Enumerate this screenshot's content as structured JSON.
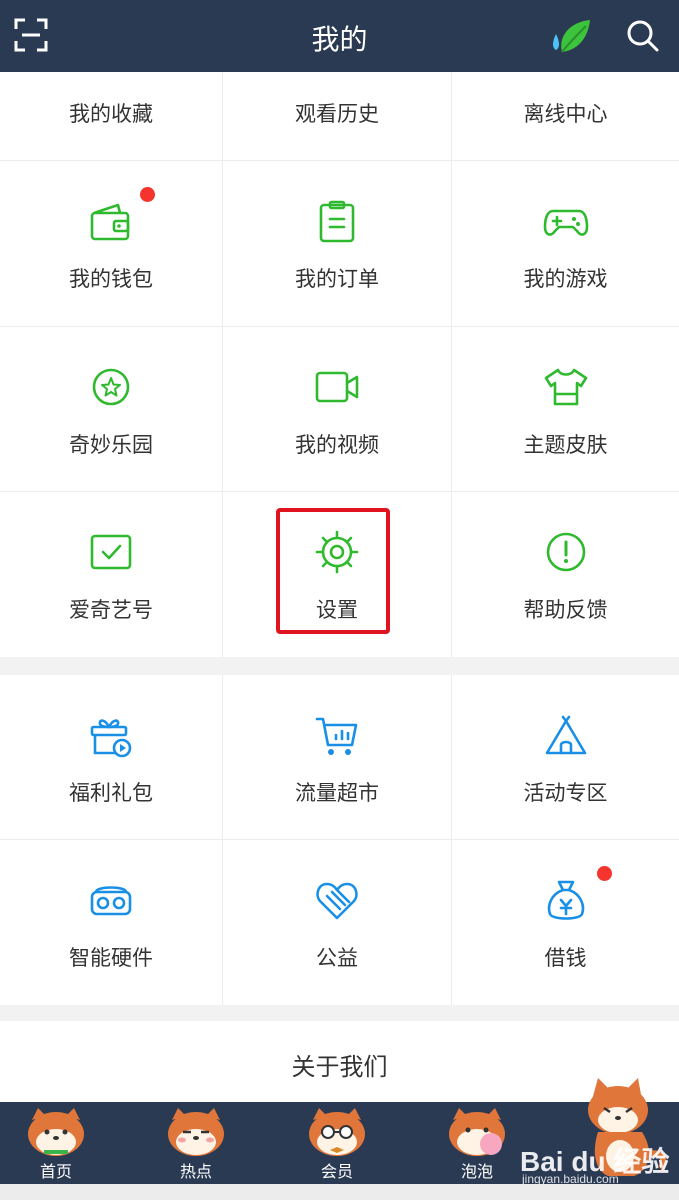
{
  "header": {
    "title": "我的"
  },
  "grid_top": [
    {
      "id": "favorites",
      "label": "我的收藏",
      "icon": "star-icon"
    },
    {
      "id": "history",
      "label": "观看历史",
      "icon": "clock-icon"
    },
    {
      "id": "offline",
      "label": "离线中心",
      "icon": "download-icon"
    },
    {
      "id": "wallet",
      "label": "我的钱包",
      "icon": "wallet-icon",
      "badge": true
    },
    {
      "id": "orders",
      "label": "我的订单",
      "icon": "clipboard-icon"
    },
    {
      "id": "games",
      "label": "我的游戏",
      "icon": "gamepad-icon"
    },
    {
      "id": "park",
      "label": "奇妙乐园",
      "icon": "star-circle-icon"
    },
    {
      "id": "videos",
      "label": "我的视频",
      "icon": "video-camera-icon"
    },
    {
      "id": "themes",
      "label": "主题皮肤",
      "icon": "tshirt-icon"
    },
    {
      "id": "iqiyi-id",
      "label": "爱奇艺号",
      "icon": "tv-check-icon"
    },
    {
      "id": "settings",
      "label": "设置",
      "icon": "gear-icon"
    },
    {
      "id": "help",
      "label": "帮助反馈",
      "icon": "exclamation-circle-icon"
    }
  ],
  "grid_bottom": [
    {
      "id": "gifts",
      "label": "福利礼包",
      "icon": "gift-icon"
    },
    {
      "id": "data-market",
      "label": "流量超市",
      "icon": "cart-icon"
    },
    {
      "id": "events",
      "label": "活动专区",
      "icon": "tent-icon"
    },
    {
      "id": "hardware",
      "label": "智能硬件",
      "icon": "vr-headset-icon"
    },
    {
      "id": "charity",
      "label": "公益",
      "icon": "heart-icon"
    },
    {
      "id": "loan",
      "label": "借钱",
      "icon": "money-bag-icon",
      "badge": true
    }
  ],
  "about": {
    "label": "关于我们"
  },
  "tabs": [
    {
      "id": "home",
      "label": "首页"
    },
    {
      "id": "hot",
      "label": "热点"
    },
    {
      "id": "vip",
      "label": "会员"
    },
    {
      "id": "bubble",
      "label": "泡泡"
    }
  ],
  "watermark": {
    "text": "Bai du 经验",
    "sub": "jingyan.baidu.com"
  },
  "colors": {
    "header": "#2b3a53",
    "green_icon": "#2fb92f",
    "blue_icon": "#1a8fe6",
    "highlight": "#e0141e",
    "badge": "#f5342e"
  }
}
